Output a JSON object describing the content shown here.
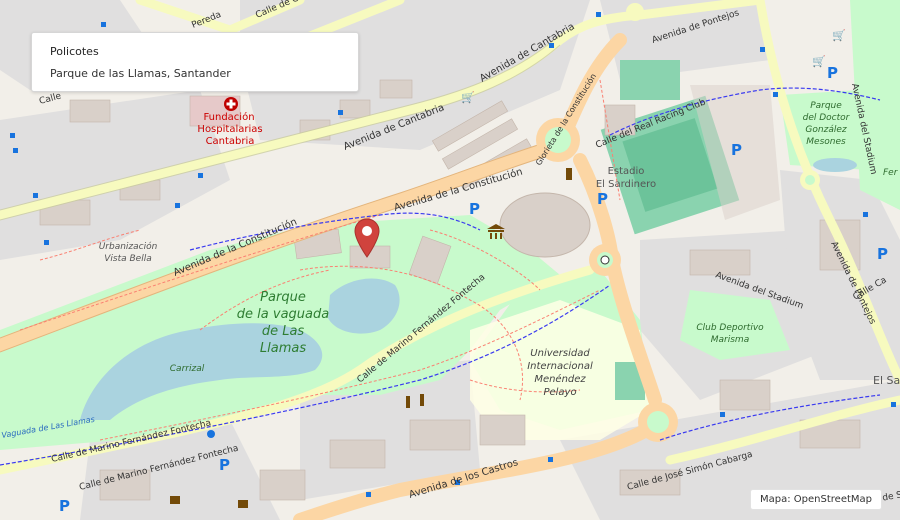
{
  "info": {
    "title": "Policotes",
    "subtitle": "Parque de las Llamas, Santander"
  },
  "attribution": "Mapa: OpenStreetMap",
  "map": {
    "marker_icon": "map-pin-icon",
    "colors": {
      "land": "#f2efe9",
      "park": "#c8facc",
      "water": "#aad3df",
      "major_road": "#fcd6a4",
      "secondary_road": "#f7fabf",
      "building": "#d9d0c9",
      "stadium": "#8ad3af",
      "university": "#ffffe5",
      "marker": "#d0433d"
    },
    "labels": {
      "consuelo": "Calle de Consuelo Berges",
      "pereda": "Pereda",
      "pontejos_top": "Avenida de Pontejos",
      "cantabria_1": "Avenida de Cantabria",
      "cantabria_2": "Avenida de Cantabria",
      "fundacion_1": "Fundación",
      "fundacion_2": "Hospitalarias",
      "fundacion_3": "Cantabria",
      "constitucion_1": "Avenida de la Constitución",
      "constitucion_2": "Avenida de la Constitución",
      "glorieta": "Glorieta de la Constitución",
      "real_racing": "Calle del Real Racing Club",
      "estadio_1": "Estadio",
      "estadio_2": "El Sardinero",
      "parque_gonzalez_1": "Parque",
      "parque_gonzalez_2": "del Doctor",
      "parque_gonzalez_3": "González",
      "parque_gonzalez_4": "Mesones",
      "avenida_stadium": "Avenida del Stadium",
      "avenida_pontejos": "Avenida de Pontejos",
      "avenida_stadium_right": "Avenida del Stadium",
      "fer": "Fer",
      "urbanizacion_1": "Urbanización",
      "urbanizacion_2": "Vista Bella",
      "parque_llamas_1": "Parque",
      "parque_llamas_2": "de la vaguada",
      "parque_llamas_3": "de Las",
      "parque_llamas_4": "Llamas",
      "club_1": "Club Deportivo",
      "club_2": "Marisma",
      "carrizal": "Carrizal",
      "vaguada": "Vaguada de Las Llamas",
      "marino_1": "Calle de Marino Fernández Fontecha",
      "marino_2": "Calle de Marino Fernández Fontecha",
      "marino_3": "Calle de Marino Fernández Fontecha",
      "universidad_1": "Universidad",
      "universidad_2": "Internacional",
      "universidad_3": "Menéndez",
      "universidad_4": "Pelayo",
      "el_sa": "El Sa",
      "los_castros": "Avenida de los Castros",
      "simon_cabarga": "Calle de José Simón Cabarga",
      "calle_left": "Calle",
      "calle_ca": "Calle Ca",
      "calle_sa": "Calle de Sa"
    }
  }
}
